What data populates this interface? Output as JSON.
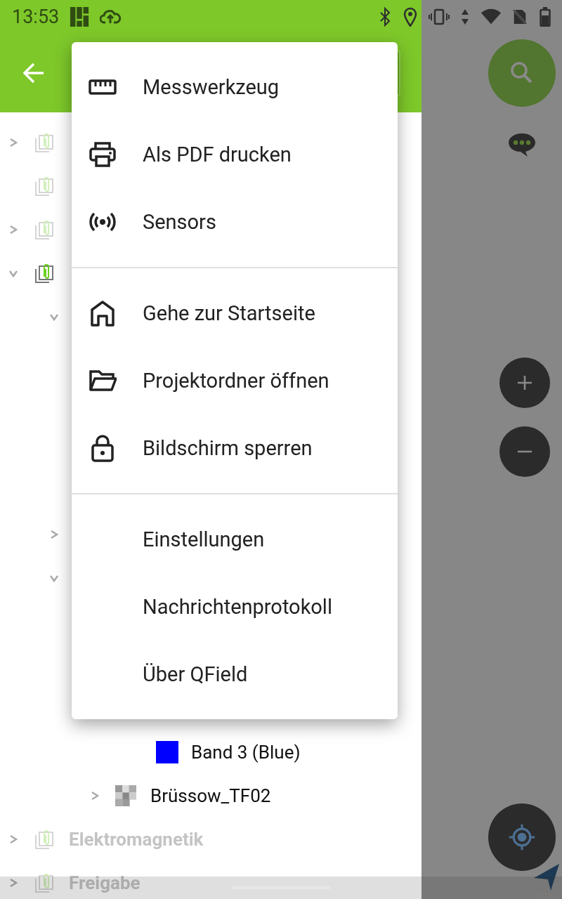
{
  "status_bar": {
    "time": "13:53"
  },
  "layer_tree": [
    {
      "kind": "group",
      "visible": false,
      "expanded": false
    },
    {
      "kind": "group",
      "visible": false
    },
    {
      "kind": "group",
      "visible": false,
      "expanded": false
    },
    {
      "kind": "group",
      "visible": true,
      "expanded": true,
      "children": [
        {
          "expanded": true
        },
        {
          "expanded": false
        },
        {
          "expanded": true,
          "children": [
            {
              "children": [
                {
                  "kind": "band",
                  "label": "Band 3 (Blue)",
                  "color": "#0000ff",
                  "visible": true
                }
              ]
            },
            {
              "kind": "raster",
              "label": "Brüssow_TF02",
              "visible": true,
              "expanded": false
            }
          ]
        }
      ]
    },
    {
      "kind": "group",
      "label": "Elektromagnetik",
      "visible": false,
      "expanded": false
    },
    {
      "kind": "group",
      "label": "Freigabe",
      "visible": false,
      "expanded": false
    }
  ],
  "menu": {
    "sections": [
      [
        {
          "label": "Messwerkzeug"
        },
        {
          "label": "Als PDF drucken"
        },
        {
          "label": "Sensors"
        }
      ],
      [
        {
          "label": "Gehe zur Startseite"
        },
        {
          "label": "Projektordner öffnen"
        },
        {
          "label": "Bildschirm sperren"
        }
      ],
      [
        {
          "label": "Einstellungen"
        },
        {
          "label": "Nachrichtenprotokoll"
        },
        {
          "label": "Über QField"
        }
      ]
    ]
  }
}
